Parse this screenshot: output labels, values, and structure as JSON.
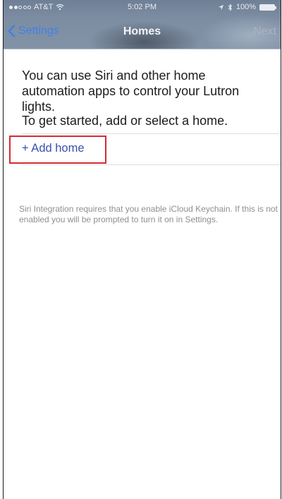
{
  "status_bar": {
    "carrier": "AT&T",
    "time": "5:02 PM",
    "battery": "100%",
    "signal_icon": "signal-dots-icon",
    "wifi_icon": "wifi-icon",
    "location_icon": "location-arrow-icon",
    "bluetooth_icon": "bluetooth-icon"
  },
  "nav": {
    "back_label": "Settings",
    "title": "Homes",
    "next_label": "Next",
    "back_color": "#3f80ea"
  },
  "content": {
    "intro": "You can use Siri and other home automation apps to control your Lutron lights.",
    "get_started": "To get started, add or select a home.",
    "add_home_label": "+ Add home",
    "footnote": "Siri Integration requires that you enable iCloud Keychain. If this is not enabled you will be prompted to turn it on in Settings."
  },
  "colors": {
    "link": "#3a4fae",
    "highlight_border": "#d52b34",
    "footnote": "#8f8f8f"
  }
}
